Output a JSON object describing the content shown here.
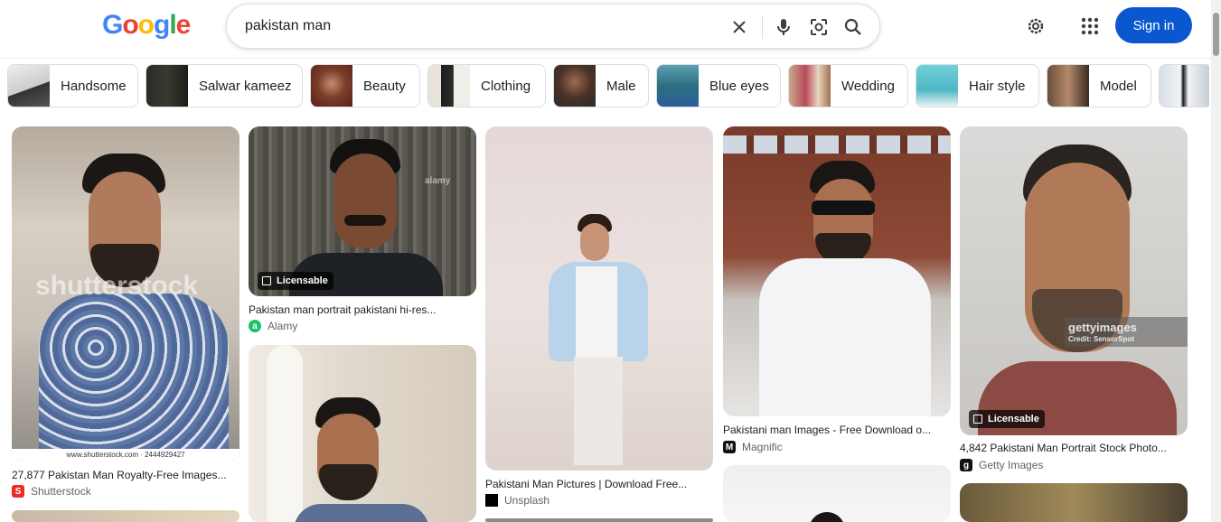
{
  "header": {
    "logo_letters": [
      "G",
      "o",
      "o",
      "g",
      "l",
      "e"
    ],
    "logo_colors": [
      "#4285f4",
      "#ea4335",
      "#fbbc05",
      "#4285f4",
      "#34a853",
      "#ea4335"
    ],
    "query": "pakistan man",
    "signin_label": "Sign in",
    "icons": [
      "close-icon",
      "microphone-icon",
      "lens-icon",
      "search-icon",
      "gear-icon",
      "apps-icon"
    ]
  },
  "chips": [
    {
      "label": "Handsome"
    },
    {
      "label": "Salwar kameez"
    },
    {
      "label": "Beauty"
    },
    {
      "label": "Clothing"
    },
    {
      "label": "Male"
    },
    {
      "label": "Blue eyes"
    },
    {
      "label": "Wedding"
    },
    {
      "label": "Hair style"
    },
    {
      "label": "Model"
    }
  ],
  "results": [
    {
      "title": "27,877 Pakistan Man Royalty-Free Images...",
      "source": "Shutterstock",
      "watermark": "shutterstock",
      "footer": "www.shutterstock.com · 2444929427"
    },
    {
      "title": "Pakistan man portrait pakistani hi-res...",
      "source": "Alamy",
      "badge": "Licensable",
      "watermark": "alamy"
    },
    {
      "title": "Pakistani Man Pictures | Download Free...",
      "source": "Unsplash"
    },
    {
      "title": "Pakistani man Images - Free Download o...",
      "source": "Magnific"
    },
    {
      "title": "4,842 Pakistani Man Portrait Stock Photo...",
      "source": "Getty Images",
      "badge": "Licensable",
      "watermark": "gettyimages",
      "credit": "Credit: SensorSpot"
    }
  ],
  "colors": {
    "accent": "#0b57d0",
    "border": "#dadce0",
    "secondary_text": "#5f6368"
  }
}
